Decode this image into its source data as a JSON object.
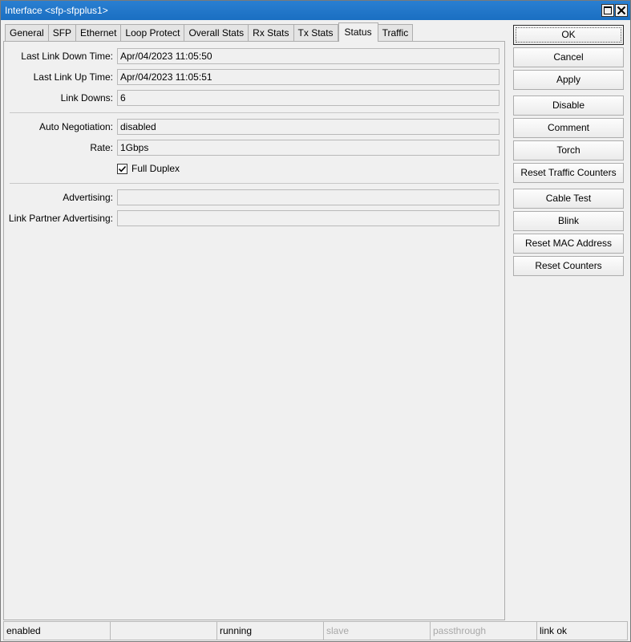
{
  "window": {
    "title": "Interface <sfp-sfpplus1>"
  },
  "tabs": [
    {
      "label": "General"
    },
    {
      "label": "SFP"
    },
    {
      "label": "Ethernet"
    },
    {
      "label": "Loop Protect"
    },
    {
      "label": "Overall Stats"
    },
    {
      "label": "Rx Stats"
    },
    {
      "label": "Tx Stats"
    },
    {
      "label": "Status",
      "active": true
    },
    {
      "label": "Traffic"
    }
  ],
  "status": {
    "last_link_down_time": {
      "label": "Last Link Down Time:",
      "value": "Apr/04/2023 11:05:50"
    },
    "last_link_up_time": {
      "label": "Last Link Up Time:",
      "value": "Apr/04/2023 11:05:51"
    },
    "link_downs": {
      "label": "Link Downs:",
      "value": "6"
    },
    "auto_negotiation": {
      "label": "Auto Negotiation:",
      "value": "disabled"
    },
    "rate": {
      "label": "Rate:",
      "value": "1Gbps"
    },
    "full_duplex": {
      "label": "Full Duplex",
      "checked": true
    },
    "advertising": {
      "label": "Advertising:",
      "value": ""
    },
    "link_partner_advertising": {
      "label": "Link Partner Advertising:",
      "value": ""
    }
  },
  "buttons": {
    "ok": "OK",
    "cancel": "Cancel",
    "apply": "Apply",
    "disable": "Disable",
    "comment": "Comment",
    "torch": "Torch",
    "reset_traffic_counters": "Reset Traffic Counters",
    "cable_test": "Cable Test",
    "blink": "Blink",
    "reset_mac_address": "Reset MAC Address",
    "reset_counters": "Reset Counters"
  },
  "statusbar": {
    "cells": [
      "enabled",
      "",
      "running",
      "slave",
      "passthrough",
      "link ok"
    ]
  },
  "colors": {
    "titlebar": "#1a6fc2",
    "background": "#f0f0f0",
    "disabled_text": "#a8a8a8"
  }
}
